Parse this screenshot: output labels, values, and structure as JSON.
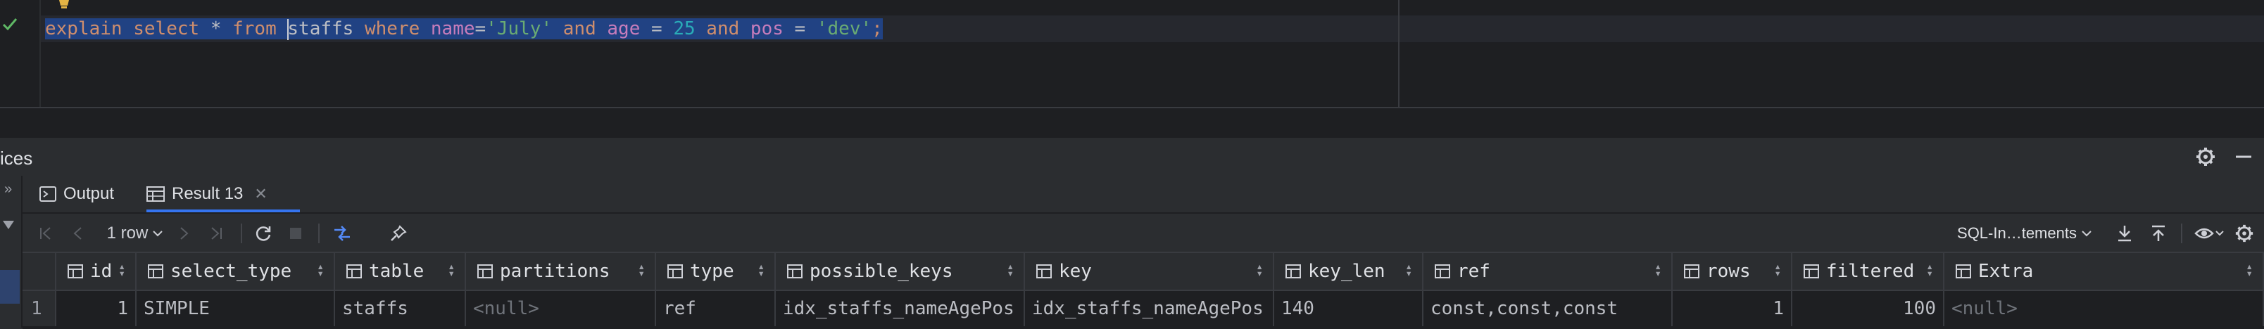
{
  "editor": {
    "sql_tokens": [
      {
        "t": "explain ",
        "c": "kw"
      },
      {
        "t": "select ",
        "c": "kw"
      },
      {
        "t": "* ",
        "c": "id"
      },
      {
        "t": "from ",
        "c": "kw"
      },
      {
        "t": "staffs ",
        "c": "id"
      },
      {
        "t": "where ",
        "c": "kw"
      },
      {
        "t": "name",
        "c": "col"
      },
      {
        "t": "=",
        "c": "id"
      },
      {
        "t": "'July'",
        "c": "str"
      },
      {
        "t": " and ",
        "c": "kw"
      },
      {
        "t": "age ",
        "c": "col"
      },
      {
        "t": "= ",
        "c": "id"
      },
      {
        "t": "25 ",
        "c": "num"
      },
      {
        "t": "and ",
        "c": "kw"
      },
      {
        "t": "pos ",
        "c": "col"
      },
      {
        "t": "= ",
        "c": "id"
      },
      {
        "t": "'dev'",
        "c": "str"
      },
      {
        "t": ";",
        "c": "kw"
      }
    ]
  },
  "services": {
    "title": "ices",
    "gear_icon": "gear-icon",
    "minimize_icon": "minimize-icon"
  },
  "tabs": {
    "output_label": "Output",
    "result_label": "Result 13",
    "close_glyph": "✕"
  },
  "toolbar": {
    "row_count": "1 row",
    "mode_label": "SQL-In…tements"
  },
  "table": {
    "columns": [
      "id",
      "select_type",
      "table",
      "partitions",
      "type",
      "possible_keys",
      "key",
      "key_len",
      "ref",
      "rows",
      "filtered",
      "Extra"
    ],
    "rows": [
      {
        "rownum": "1",
        "cells": [
          "1",
          "SIMPLE",
          "staffs",
          "<null>",
          "ref",
          "idx_staffs_nameAgePos",
          "idx_staffs_nameAgePos",
          "140",
          "const,const,const",
          "1",
          "100",
          "<null>"
        ]
      }
    ]
  },
  "colors": {
    "accent": "#3574f0",
    "selection": "#214283",
    "keyword": "#cf8e6d",
    "string": "#6aab73",
    "number": "#2aacb8",
    "column": "#c77dbb"
  }
}
